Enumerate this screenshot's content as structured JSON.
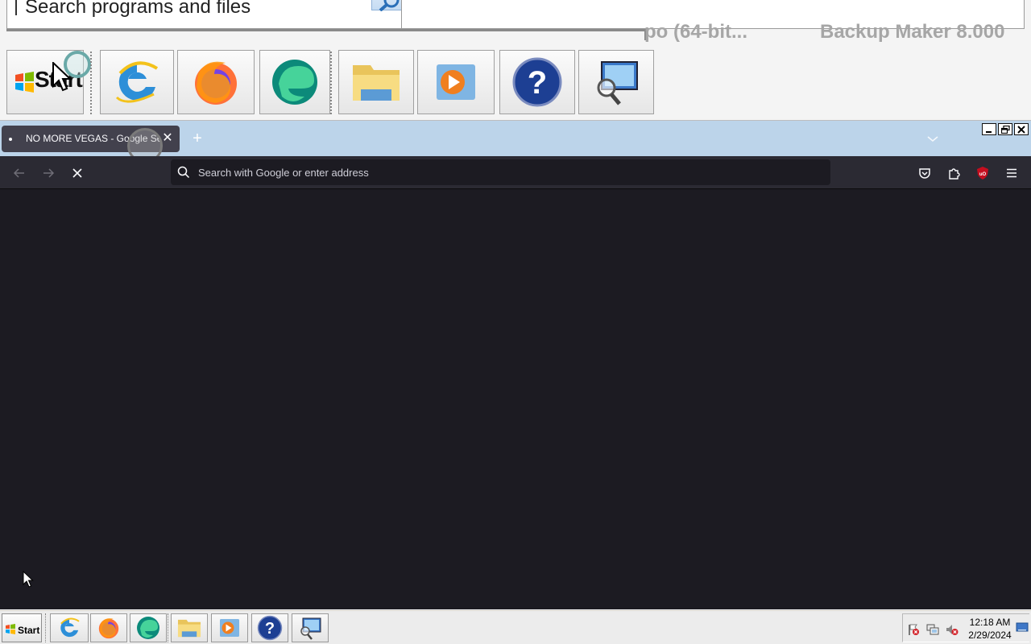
{
  "magnifier": {
    "search_text": "Search programs and files",
    "ghost_left": "po (64-bit...",
    "ghost_right": "Backup Maker 8.000",
    "start_label": "Start"
  },
  "firefox": {
    "tab": {
      "title": "NO MORE VEGAS - Google Search",
      "close_glyph": "✕"
    },
    "new_tab_glyph": "+",
    "urlbar": {
      "placeholder": "Search with Google or enter address",
      "value": ""
    },
    "ublock_badge": "uO",
    "colors": {
      "toolbar": "#2b2a33",
      "content": "#1c1b22",
      "titlebar": "#bcd4ea",
      "tab": "#42414d",
      "ublock": "#c50e1f"
    }
  },
  "taskbar": {
    "start_label": "Start",
    "buttons": [
      {
        "name": "internet-explorer-icon"
      },
      {
        "name": "firefox-icon"
      },
      {
        "name": "edge-icon"
      },
      {
        "name": "file-explorer-icon"
      },
      {
        "name": "media-player-icon"
      },
      {
        "name": "help-icon"
      },
      {
        "name": "network-search-icon"
      }
    ],
    "tray": {
      "time": "12:18 AM",
      "date": "2/29/2024"
    }
  }
}
